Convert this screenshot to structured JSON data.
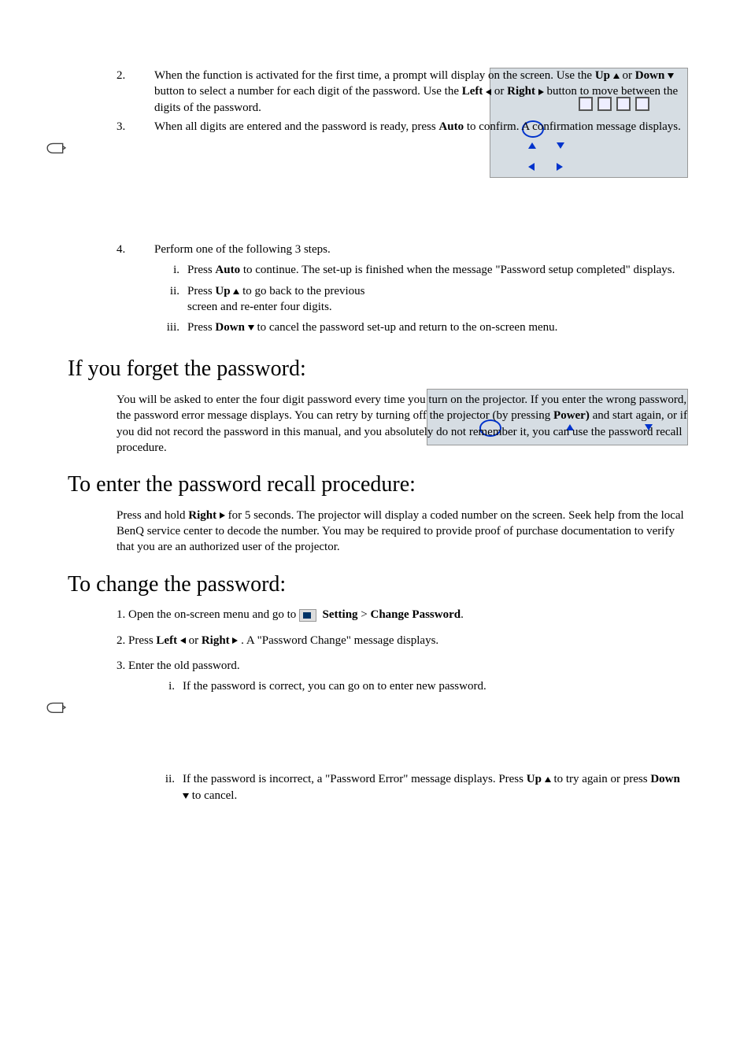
{
  "list": {
    "items": [
      {
        "num": "2.",
        "text_parts": [
          "When the function is activated for the first time, a prompt will display on the screen. Use the ",
          "Up",
          " ",
          "UP_ARROW",
          " or ",
          "Down",
          " ",
          "DOWN_ARROW",
          " button to select a number for each digit of the password. Use the ",
          "Left",
          " ",
          "LEFT_ARROW",
          " or ",
          "Right",
          " ",
          "RIGHT_ARROW",
          " button to move between the digits of the password."
        ]
      },
      {
        "num": "3.",
        "text_parts": [
          "When all digits are entered and the password is ready, press ",
          "Auto",
          " to confirm. A confirmation message displays."
        ]
      }
    ]
  },
  "note1": {
    "lines": []
  },
  "item4": {
    "num": "4.",
    "text": "Perform one of the following 3 steps.",
    "sub": [
      {
        "num": "i.",
        "parts": [
          "Press ",
          "Auto",
          " to continue. The set-up is finished when the message \"Password setup completed\" displays."
        ]
      },
      {
        "num": "ii.",
        "parts": [
          "Press ",
          "Up",
          " ",
          "UP_ARROW",
          " to go back to the previous screen and re-enter four digits."
        ]
      },
      {
        "num": "iii.",
        "parts": [
          "Press ",
          "Down",
          " ",
          "DOWN_ARROW",
          " to cancel the password set-up and return to the on-screen menu."
        ]
      }
    ]
  },
  "h_forget": "If you forget the password:",
  "p_forget": "You will be asked to enter the four digit password every time you turn on the projector. If you enter the wrong password, the password error message displays. You can retry by turning off the projector (by pressing ",
  "p_forget_b": "Power)",
  "p_forget2": " and start again, or if you did not record the password in this manual, and you absolutely do not remember it, you can use the password recall procedure.",
  "h_recall": "To enter the password recall procedure:",
  "p_recall_1": "Press and hold ",
  "p_recall_b": "Right",
  "p_recall_2": " for 5 seconds. The projector will display a coded number on the screen. Seek help from the local BenQ service center to decode the number. You may be required to provide proof of purchase documentation to verify that you are an authorized user of the projector.",
  "h_change": "To change the password:",
  "change_steps": {
    "s1_a": "1. Open the on-screen menu and go to ",
    "s1_b": "Setting",
    "s1_c": " > ",
    "s1_d": "Change Password",
    "s1_e": ".",
    "s2_a": "2. Press ",
    "s2_b": "Left",
    "s2_c": " or ",
    "s2_d": "Right",
    "s2_e": " . A \"Password Change\" message displays.",
    "s3": "3. Enter the old password.",
    "sub_i": {
      "num": "i.",
      "text": "If the password is correct, you can go on to enter new password."
    },
    "sub_ii": {
      "num": "ii.",
      "a": "If the password is incorrect, a \"Password Error\" message displays. Press ",
      "b": "Up",
      "c": " to try again or press ",
      "d": "Down",
      "e": " to cancel."
    }
  }
}
